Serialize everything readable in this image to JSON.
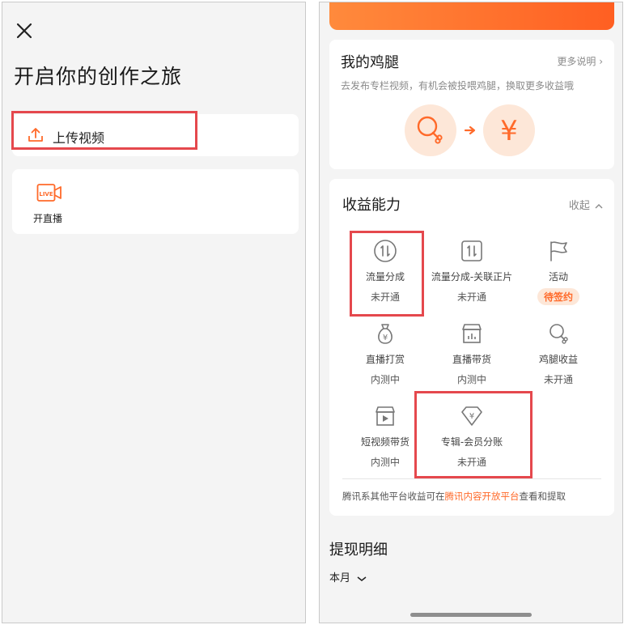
{
  "left": {
    "title": "开启你的创作之旅",
    "upload_label": "上传视频",
    "live_label": "开直播",
    "live_icon_text": "LIVE"
  },
  "right": {
    "drumstick": {
      "title": "我的鸡腿",
      "more": "更多说明 ›",
      "desc": "去发布专栏视频，有机会被投喂鸡腿，换取更多收益哦",
      "yen": "¥"
    },
    "income": {
      "title": "收益能力",
      "collapse": "收起",
      "items": [
        {
          "label": "流量分成",
          "status": "未开通",
          "icon": "traffic-share-icon"
        },
        {
          "label": "流量分成-关联正片",
          "status": "未开通",
          "icon": "traffic-share-linked-icon"
        },
        {
          "label": "活动",
          "status": "待签约",
          "icon": "flag-icon"
        },
        {
          "label": "直播打赏",
          "status": "内测中",
          "icon": "money-bag-icon"
        },
        {
          "label": "直播带货",
          "status": "内测中",
          "icon": "store-icon"
        },
        {
          "label": "鸡腿收益",
          "status": "未开通",
          "icon": "drumstick-icon"
        },
        {
          "label": "短视频带货",
          "status": "内测中",
          "icon": "video-store-icon"
        },
        {
          "label": "专辑-会员分账",
          "status": "未开通",
          "icon": "diamond-yen-icon"
        }
      ],
      "footnote_pre": "腾讯系其他平台收益可在",
      "footnote_link": "腾讯内容开放平台",
      "footnote_post": "查看和提取"
    },
    "withdraw": {
      "title": "提现明细",
      "month": "本月"
    }
  },
  "colors": {
    "accent": "#ff6a2a",
    "highlight": "#e5484d",
    "badge_bg": "#fde7d8"
  }
}
